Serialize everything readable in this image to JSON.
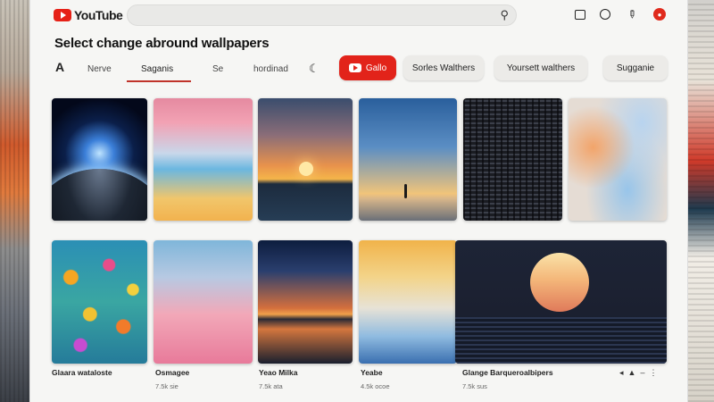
{
  "app": {
    "logo_text": "YouTube"
  },
  "search": {
    "placeholder": "",
    "icon": "search-icon"
  },
  "top_icons": [
    "cast-icon",
    "account-circle-icon",
    "edit-icon",
    "notification-icon"
  ],
  "page_title": "Select change abround wallpapers",
  "nav": {
    "home_glyph": "A",
    "tabs": [
      {
        "label": "Nerve"
      },
      {
        "label": "Saganis"
      },
      {
        "label": "Se"
      },
      {
        "label": "hordinad"
      }
    ],
    "moon_glyph": "☾",
    "chips": [
      {
        "label": "Gallo"
      },
      {
        "label": "Sorles Walthers"
      },
      {
        "label": "Yoursett walthers"
      },
      {
        "label": "Sugganie"
      }
    ]
  },
  "grid_row2_meta": [
    {
      "title": "Glaara wataloste",
      "sub": ""
    },
    {
      "title": "Osmagee",
      "sub": "7.5k sie"
    },
    {
      "title": "Yeao Milka",
      "sub": "7.5k ata"
    },
    {
      "title": "Yeabe",
      "sub": "4.5k ocoe"
    },
    {
      "title": "Glange Barqueroalbipers",
      "sub": "7.5k sus"
    }
  ],
  "row_actions": [
    "◂",
    "▲",
    "–",
    "⋮"
  ]
}
